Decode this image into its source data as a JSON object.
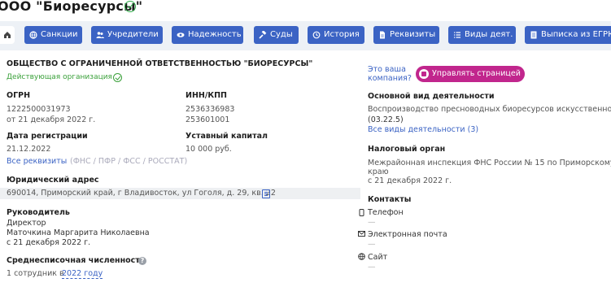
{
  "title": "ООО \"Биоресурсы\"",
  "toolbar": {
    "sanctions": "Санкции",
    "founders": "Учредители",
    "reliability": "Надежность",
    "courts": "Суды",
    "history": "История",
    "requisites": "Реквизиты",
    "activities": "Виды деят.",
    "egrul": "Выписка из ЕГРЮЛ"
  },
  "company": {
    "full_name": "ОБЩЕСТВО С ОГРАНИЧЕННОЙ ОТВЕТСТВЕННОСТЬЮ \"БИОРЕСУРСЫ\"",
    "status": "Действующая организация"
  },
  "ogrn": {
    "label": "ОГРН",
    "value": "1222500031973",
    "date": "от 21 декабря 2022 г."
  },
  "inn": {
    "label": "ИНН/КПП",
    "inn": "2536336983",
    "kpp": "253601001"
  },
  "registration": {
    "label": "Дата регистрации",
    "value": "21.12.2022"
  },
  "capital": {
    "label": "Уставный капитал",
    "value": "10 000 руб."
  },
  "all_requisites": {
    "link": "Все реквизиты",
    "note": "(ФНС / ПФР / ФСС / РОССТАТ)"
  },
  "address": {
    "label": "Юридический адрес",
    "value": "690014, Приморский край, г Владивосток, ул Гоголя, д. 29, кв. 22"
  },
  "head": {
    "label": "Руководитель",
    "role": "Директор",
    "name": "Маточкина Маргарита Николаевна",
    "date": "с 21 декабря 2022 г."
  },
  "employees": {
    "label": "Среднесписочная численность",
    "prefix": "1 сотрудник в",
    "year_link": "2022 году"
  },
  "owner_prompt": {
    "line1": "Это ваша",
    "line2": "компания?",
    "button": "Управлять страницей"
  },
  "main_activity": {
    "label": "Основной вид деятельности",
    "text": "Воспроизводство пресноводных биоресурсов искусственное",
    "code": "(03.22.5)",
    "all_link": "Все виды деятельности (3)"
  },
  "tax": {
    "label": "Налоговый орган",
    "line1": "Межрайонная инспекция ФНС России № 15 по Приморскому",
    "line2": "краю",
    "date": "с 21 декабря 2022 г."
  },
  "contacts": {
    "label": "Контакты",
    "phone": "Телефон",
    "phone_value": "—",
    "email": "Электронная почта",
    "email_value": "—",
    "site": "Сайт",
    "site_value": "—"
  },
  "colors": {
    "accent": "#3b63c4",
    "manage": "#c1268d",
    "ok": "#2fae4a",
    "toolbar_bg": "#edf1f6"
  }
}
